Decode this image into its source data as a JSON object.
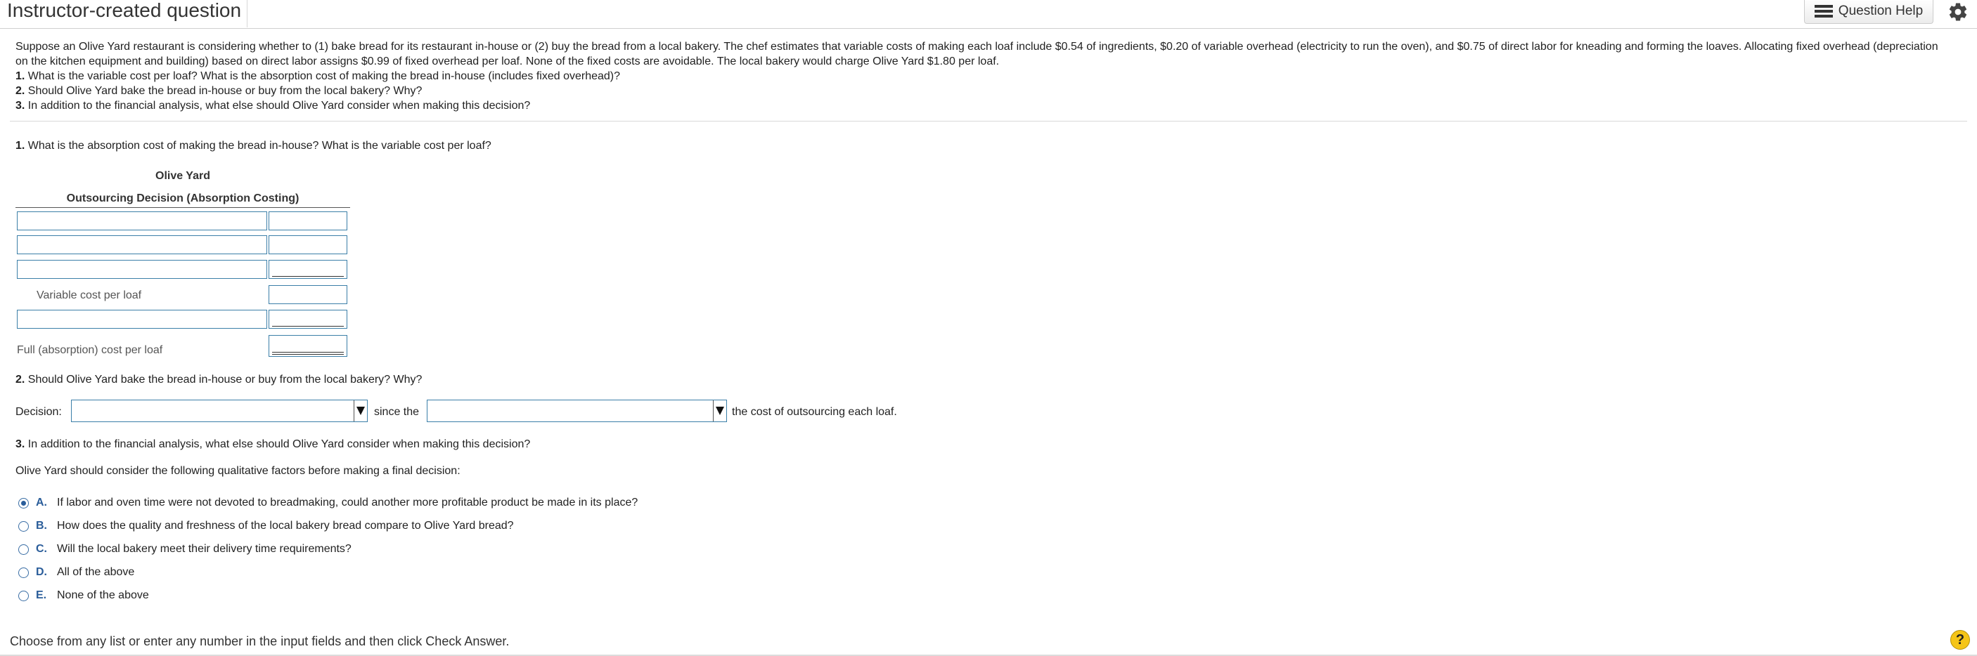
{
  "header": {
    "title": "Instructor-created question",
    "question_help_label": "Question Help",
    "help_icon": "list-icon",
    "settings_icon": "gear-icon"
  },
  "problem": {
    "intro": "Suppose an Olive Yard restaurant is considering whether to (1) bake bread for its restaurant in-house or (2) buy the bread from a local bakery. The chef estimates that variable costs of making each loaf include $0.54 of ingredients, $0.20 of variable overhead (electricity to run the oven), and $0.75 of direct labor for kneading and forming the loaves. Allocating fixed overhead (depreciation on the kitchen equipment and building) based on direct labor assigns $0.99 of fixed overhead per loaf. None of the fixed costs are avoidable. The local bakery would charge Olive Yard $1.80 per loaf.",
    "questions": [
      {
        "num": "1.",
        "text": "What is the variable cost per loaf? What is the absorption cost of making the bread in-house (includes fixed overhead)?"
      },
      {
        "num": "2.",
        "text": "Should Olive Yard bake the bread in-house or buy from the local bakery? Why?"
      },
      {
        "num": "3.",
        "text": "In addition to the financial analysis, what else should Olive Yard consider when making this decision?"
      }
    ]
  },
  "part1": {
    "num": "1.",
    "question": "What is the absorption cost of making the bread in-house? What is the variable cost per loaf?",
    "table_title": "Olive Yard",
    "table_subtitle": "Outsourcing Decision (Absorption Costing)",
    "variable_label": "Variable cost per loaf",
    "full_label": "Full (absorption) cost per loaf"
  },
  "part2": {
    "num": "2.",
    "question": "Should Olive Yard bake the bread in-house or buy from the local bakery? Why?",
    "decision_label": "Decision:",
    "since_text": "since the",
    "tail_text": "the cost of outsourcing each loaf.",
    "decision_value": "",
    "comparison_value": ""
  },
  "part3": {
    "num": "3.",
    "question": "In addition to the financial analysis, what else should Olive Yard consider when making this decision?",
    "prompt": "Olive Yard should consider the following qualitative factors before making a final decision:",
    "options": [
      {
        "letter": "A.",
        "text": "If labor and oven time were not devoted to breadmaking, could another more profitable product be made in its place?",
        "selected": true
      },
      {
        "letter": "B.",
        "text": "How does the quality and freshness of the local bakery bread compare to Olive Yard bread?",
        "selected": false
      },
      {
        "letter": "C.",
        "text": "Will the local bakery meet their delivery time requirements?",
        "selected": false
      },
      {
        "letter": "D.",
        "text": "All of the above",
        "selected": false
      },
      {
        "letter": "E.",
        "text": "None of the above",
        "selected": false
      }
    ]
  },
  "footer": {
    "instruction": "Choose from any list or enter any number in the input fields and then click Check Answer.",
    "help_symbol": "?"
  }
}
